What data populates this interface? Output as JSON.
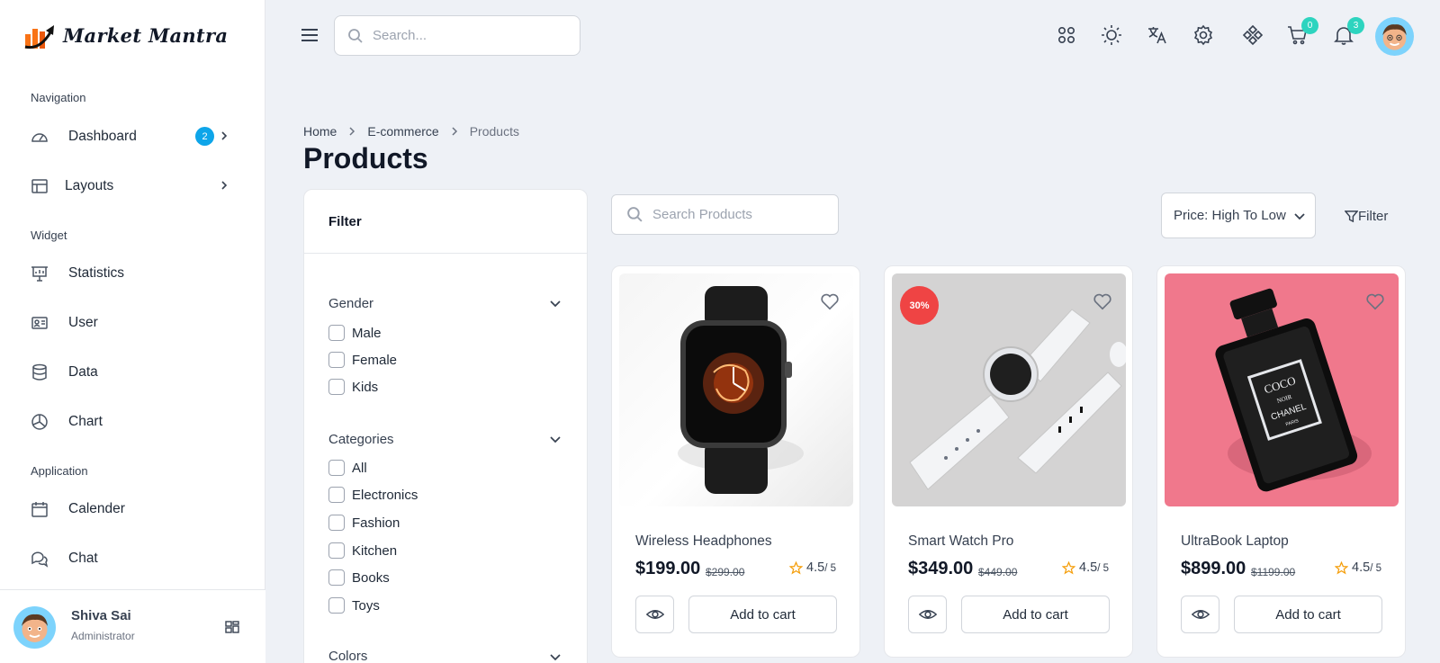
{
  "brand": {
    "name": "Market Mantra"
  },
  "header": {
    "search_placeholder": "Search...",
    "cart_count": "0",
    "notification_count": "3"
  },
  "sidebar": {
    "sections": [
      "Navigation",
      "Widget",
      "Application"
    ],
    "items": [
      {
        "label": "Dashboard",
        "badge": "2"
      },
      {
        "label": "Layouts"
      },
      {
        "label": "Statistics"
      },
      {
        "label": "User"
      },
      {
        "label": "Data"
      },
      {
        "label": "Chart"
      },
      {
        "label": "Calender"
      },
      {
        "label": "Chat"
      }
    ],
    "profile": {
      "name": "Shiva Sai",
      "role": "Administrator"
    }
  },
  "breadcrumb": [
    "Home",
    "E-commerce",
    "Products"
  ],
  "page": {
    "title": "Products"
  },
  "filter": {
    "title": "Filter",
    "groups": [
      {
        "title": "Gender",
        "options": [
          "Male",
          "Female",
          "Kids"
        ]
      },
      {
        "title": "Categories",
        "options": [
          "All",
          "Electronics",
          "Fashion",
          "Kitchen",
          "Books",
          "Toys"
        ]
      },
      {
        "title": "Colors",
        "options": []
      }
    ]
  },
  "toolbar": {
    "search_placeholder": "Search Products",
    "sort_value": "Price: High To Low",
    "filter_label": "Filter"
  },
  "products": [
    {
      "name": "Wireless Headphones",
      "price": "$199.00",
      "old_price": "$299.00",
      "rating": "4.5",
      "rating_max": "/ 5",
      "discount": "",
      "cart_label": "Add to cart"
    },
    {
      "name": "Smart Watch Pro",
      "price": "$349.00",
      "old_price": "$449.00",
      "rating": "4.5",
      "rating_max": "/ 5",
      "discount": "30%",
      "cart_label": "Add to cart"
    },
    {
      "name": "UltraBook Laptop",
      "price": "$899.00",
      "old_price": "$1199.00",
      "rating": "4.5",
      "rating_max": "/ 5",
      "discount": "",
      "cart_label": "Add to cart"
    }
  ],
  "colors": {
    "accent_badge": "#0ea5e9",
    "notification_badge": "#2dd4bf",
    "discount": "#ef4444",
    "star": "#f59e0b",
    "logo_orange": "#f97316"
  }
}
